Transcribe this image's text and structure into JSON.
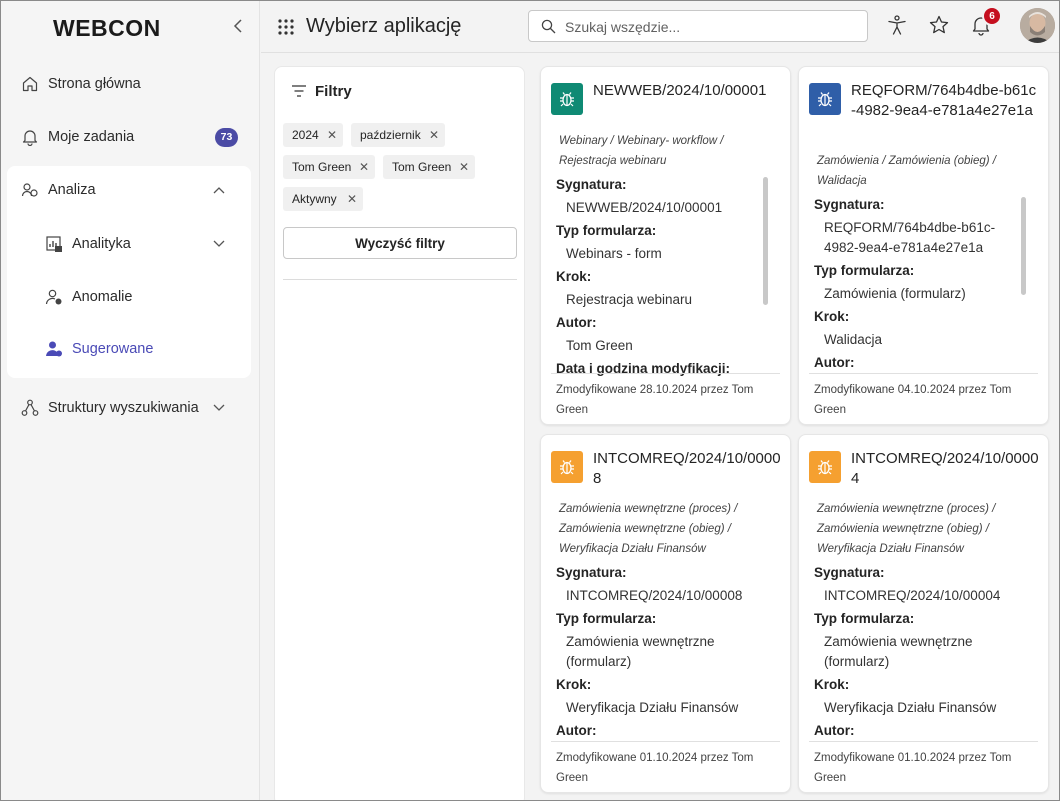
{
  "brand": {
    "logo": "WEBCON",
    "accent": "#4b4ba5"
  },
  "sidebar": {
    "items": [
      {
        "label": "Strona główna",
        "icon": "home-icon"
      },
      {
        "label": "Moje zadania",
        "icon": "bell-icon",
        "badge": "73"
      },
      {
        "label": "Analiza",
        "icon": "analytics-icon"
      },
      {
        "label": "Struktury wyszukiwania",
        "icon": "structure-icon"
      }
    ],
    "analiza_sub": [
      {
        "label": "Analityka",
        "icon": "chart-icon"
      },
      {
        "label": "Anomalie",
        "icon": "person-alert-icon"
      },
      {
        "label": "Sugerowane",
        "icon": "person-suggested-icon",
        "active": true
      }
    ]
  },
  "header": {
    "title": "Wybierz aplikację",
    "search_placeholder": "Szukaj wszędzie...",
    "notifications_count": "6"
  },
  "filters": {
    "title": "Filtry",
    "chips": [
      "2024",
      "październik",
      "Tom Green",
      "Tom Green",
      "Aktywny"
    ],
    "clear_label": "Wyczyść filtry"
  },
  "cards": [
    {
      "title": "NEWWEB/2024/10/00001",
      "icon_color": "#0f8a74",
      "path": "Webinary / Webinary- workflow / Rejestracja webinaru",
      "fields": [
        {
          "label": "Sygnatura:",
          "value": "NEWWEB/2024/10/00001"
        },
        {
          "label": "Typ formularza:",
          "value": "Webinars - form"
        },
        {
          "label": "Krok:",
          "value": "Rejestracja webinaru"
        },
        {
          "label": "Autor:",
          "value": "Tom Green"
        },
        {
          "label": "Data i godzina modyfikacji:",
          "value": ""
        }
      ],
      "footer": "Zmodyfikowane 28.10.2024 przez Tom Green"
    },
    {
      "title": "REQFORM/764b4dbe-b61c-4982-9ea4-e781a4e27e1a",
      "icon_color": "#2f5ea8",
      "path": "Zamówienia / Zamówienia (obieg) / Walidacja",
      "fields": [
        {
          "label": "Sygnatura:",
          "value": "REQFORM/764b4dbe-b61c-4982-9ea4-e781a4e27e1a"
        },
        {
          "label": "Typ formularza:",
          "value": "Zamówienia (formularz)"
        },
        {
          "label": "Krok:",
          "value": "Walidacja"
        },
        {
          "label": "Autor:",
          "value": ""
        }
      ],
      "footer": "Zmodyfikowane 04.10.2024 przez Tom Green"
    },
    {
      "title": "INTCOMREQ/2024/10/00008",
      "icon_color": "#f5a030",
      "path": "Zamówienia wewnętrzne (proces) / Zamówienia wewnętrzne (obieg) / Weryfikacja Działu Finansów",
      "fields": [
        {
          "label": "Sygnatura:",
          "value": "INTCOMREQ/2024/10/00008"
        },
        {
          "label": "Typ formularza:",
          "value": "Zamówienia wewnętrzne (formularz)"
        },
        {
          "label": "Krok:",
          "value": "Weryfikacja Działu Finansów"
        },
        {
          "label": "Autor:",
          "value": ""
        }
      ],
      "footer": "Zmodyfikowane 01.10.2024 przez Tom Green"
    },
    {
      "title": "INTCOMREQ/2024/10/00004",
      "icon_color": "#f5a030",
      "path": "Zamówienia wewnętrzne (proces) / Zamówienia wewnętrzne (obieg) / Weryfikacja Działu Finansów",
      "fields": [
        {
          "label": "Sygnatura:",
          "value": "INTCOMREQ/2024/10/00004"
        },
        {
          "label": "Typ formularza:",
          "value": "Zamówienia wewnętrzne (formularz)"
        },
        {
          "label": "Krok:",
          "value": "Weryfikacja Działu Finansów"
        },
        {
          "label": "Autor:",
          "value": ""
        }
      ],
      "footer": "Zmodyfikowane 01.10.2024 przez Tom Green"
    }
  ]
}
